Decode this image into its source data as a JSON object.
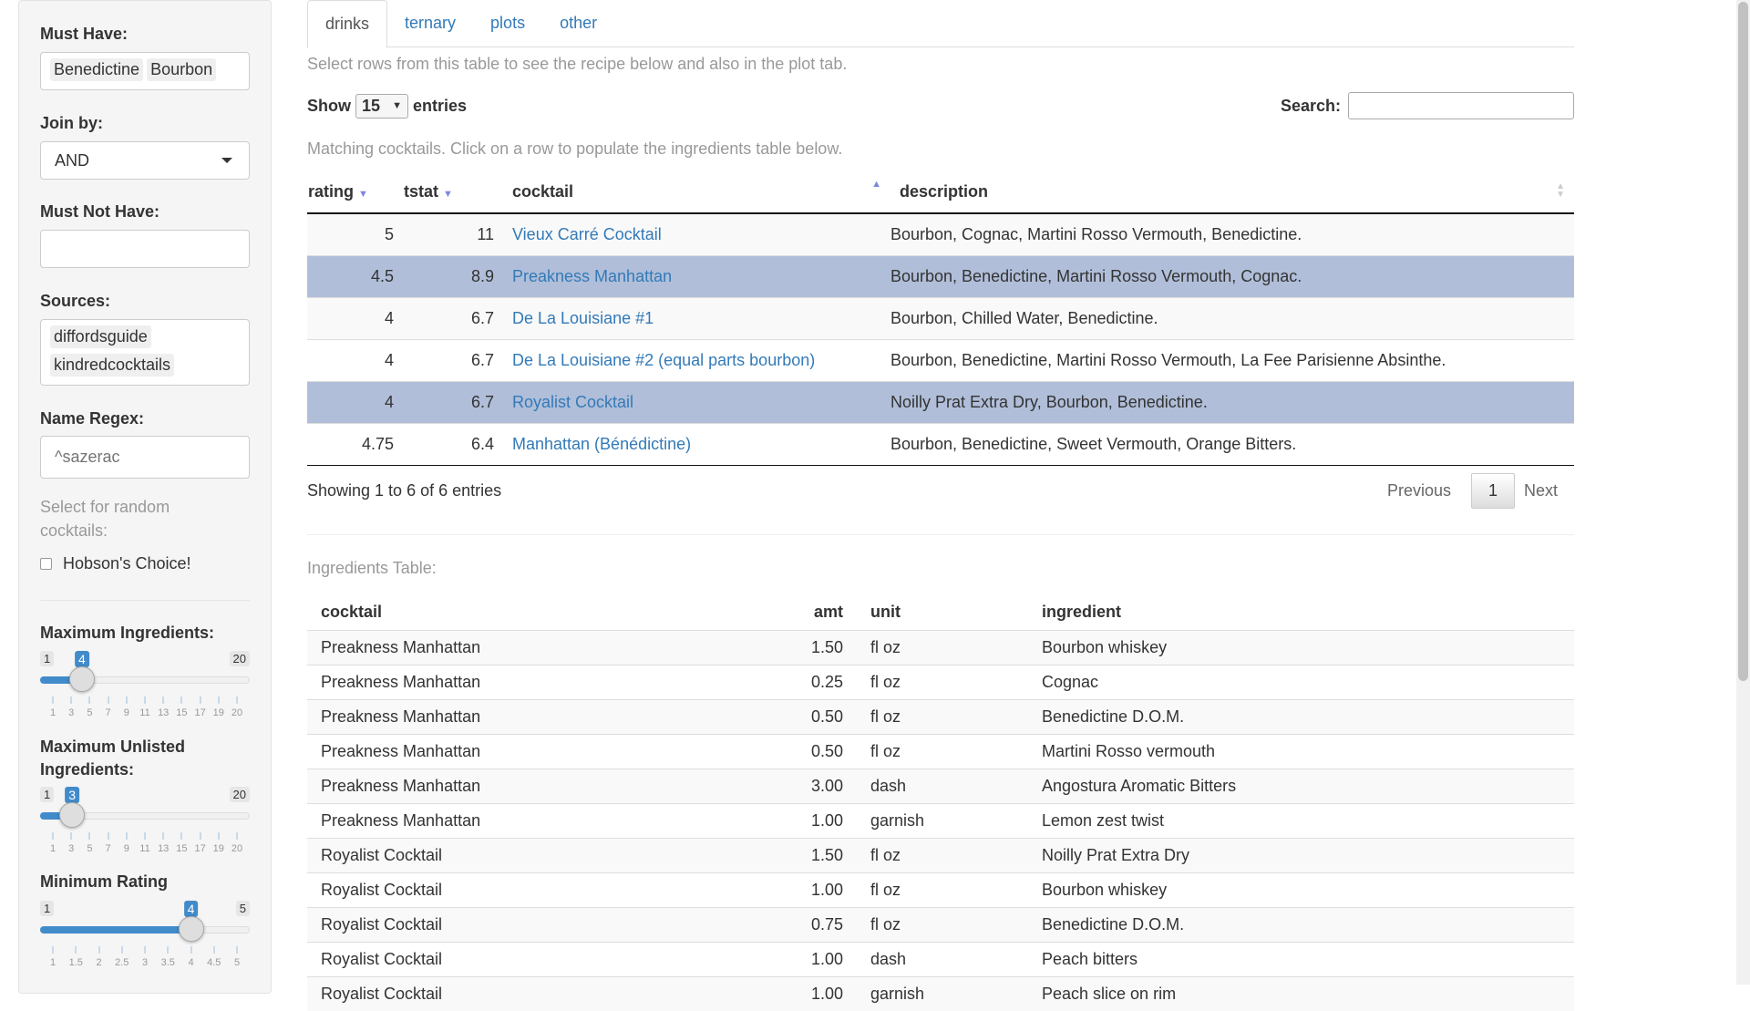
{
  "sidebar": {
    "must_have": {
      "label": "Must Have:",
      "values": [
        "Benedictine",
        "Bourbon"
      ]
    },
    "join_by": {
      "label": "Join by:",
      "value": "AND"
    },
    "must_not_have": {
      "label": "Must Not Have:",
      "value": ""
    },
    "sources": {
      "label": "Sources:",
      "values": [
        "diffordsguide",
        "kindredcocktails"
      ]
    },
    "name_regex": {
      "label": "Name Regex:",
      "placeholder": "^sazerac"
    },
    "random_text": "Select for random cocktails:",
    "hobson": {
      "label": "Hobson's Choice!",
      "checked": false
    },
    "sliders": [
      {
        "label": "Maximum Ingredients:",
        "min": "1",
        "max": "20",
        "value": "4",
        "fraction": 0.158,
        "ticks": [
          "1",
          "3",
          "5",
          "7",
          "9",
          "11",
          "13",
          "15",
          "17",
          "19",
          "20"
        ]
      },
      {
        "label": "Maximum Unlisted Ingredients:",
        "min": "1",
        "max": "20",
        "value": "3",
        "fraction": 0.105,
        "ticks": [
          "1",
          "3",
          "5",
          "7",
          "9",
          "11",
          "13",
          "15",
          "17",
          "19",
          "20"
        ]
      },
      {
        "label": "Minimum Rating",
        "min": "1",
        "max": "5",
        "value": "4",
        "fraction": 0.75,
        "ticks": [
          "1",
          "1.5",
          "2",
          "2.5",
          "3",
          "3.5",
          "4",
          "4.5",
          "5"
        ]
      }
    ]
  },
  "tabs": [
    "drinks",
    "ternary",
    "plots",
    "other"
  ],
  "active_tab": "drinks",
  "intro": "Select rows from this table to see the recipe below and also in the plot tab.",
  "show": {
    "prefix": "Show",
    "value": "15",
    "suffix": "entries"
  },
  "search": {
    "label": "Search:",
    "value": ""
  },
  "matching_text": "Matching cocktails. Click on a row to populate the ingredients table below.",
  "drinks_table": {
    "columns": [
      "rating",
      "tstat",
      "cocktail",
      "description"
    ],
    "rows": [
      {
        "rating": "5",
        "tstat": "11",
        "cocktail": "Vieux Carré Cocktail",
        "description": "Bourbon, Cognac, Martini Rosso Vermouth, Benedictine.",
        "selected": false
      },
      {
        "rating": "4.5",
        "tstat": "8.9",
        "cocktail": "Preakness Manhattan",
        "description": "Bourbon, Benedictine, Martini Rosso Vermouth, Cognac.",
        "selected": true
      },
      {
        "rating": "4",
        "tstat": "6.7",
        "cocktail": "De La Louisiane #1",
        "description": "Bourbon, Chilled Water, Benedictine.",
        "selected": false
      },
      {
        "rating": "4",
        "tstat": "6.7",
        "cocktail": "De La Louisiane #2 (equal parts bourbon)",
        "description": "Bourbon, Benedictine, Martini Rosso Vermouth, La Fee Parisienne Absinthe.",
        "selected": false
      },
      {
        "rating": "4",
        "tstat": "6.7",
        "cocktail": "Royalist Cocktail",
        "description": "Noilly Prat Extra Dry, Bourbon, Benedictine.",
        "selected": true
      },
      {
        "rating": "4.75",
        "tstat": "6.4",
        "cocktail": "Manhattan (Bénédictine)",
        "description": "Bourbon, Benedictine, Sweet Vermouth, Orange Bitters.",
        "selected": false
      }
    ],
    "info": "Showing 1 to 6 of 6 entries",
    "pager": {
      "previous": "Previous",
      "page": "1",
      "next": "Next"
    }
  },
  "ingredients": {
    "title": "Ingredients Table:",
    "columns": [
      "cocktail",
      "amt",
      "unit",
      "ingredient"
    ],
    "rows": [
      [
        "Preakness Manhattan",
        "1.50",
        "fl oz",
        "Bourbon whiskey"
      ],
      [
        "Preakness Manhattan",
        "0.25",
        "fl oz",
        "Cognac"
      ],
      [
        "Preakness Manhattan",
        "0.50",
        "fl oz",
        "Benedictine D.O.M."
      ],
      [
        "Preakness Manhattan",
        "0.50",
        "fl oz",
        "Martini Rosso vermouth"
      ],
      [
        "Preakness Manhattan",
        "3.00",
        "dash",
        "Angostura Aromatic Bitters"
      ],
      [
        "Preakness Manhattan",
        "1.00",
        "garnish",
        "Lemon zest twist"
      ],
      [
        "Royalist Cocktail",
        "1.50",
        "fl oz",
        "Noilly Prat Extra Dry"
      ],
      [
        "Royalist Cocktail",
        "1.00",
        "fl oz",
        "Bourbon whiskey"
      ],
      [
        "Royalist Cocktail",
        "0.75",
        "fl oz",
        "Benedictine D.O.M."
      ],
      [
        "Royalist Cocktail",
        "1.00",
        "dash",
        "Peach bitters"
      ],
      [
        "Royalist Cocktail",
        "1.00",
        "garnish",
        "Peach slice on rim"
      ]
    ]
  }
}
